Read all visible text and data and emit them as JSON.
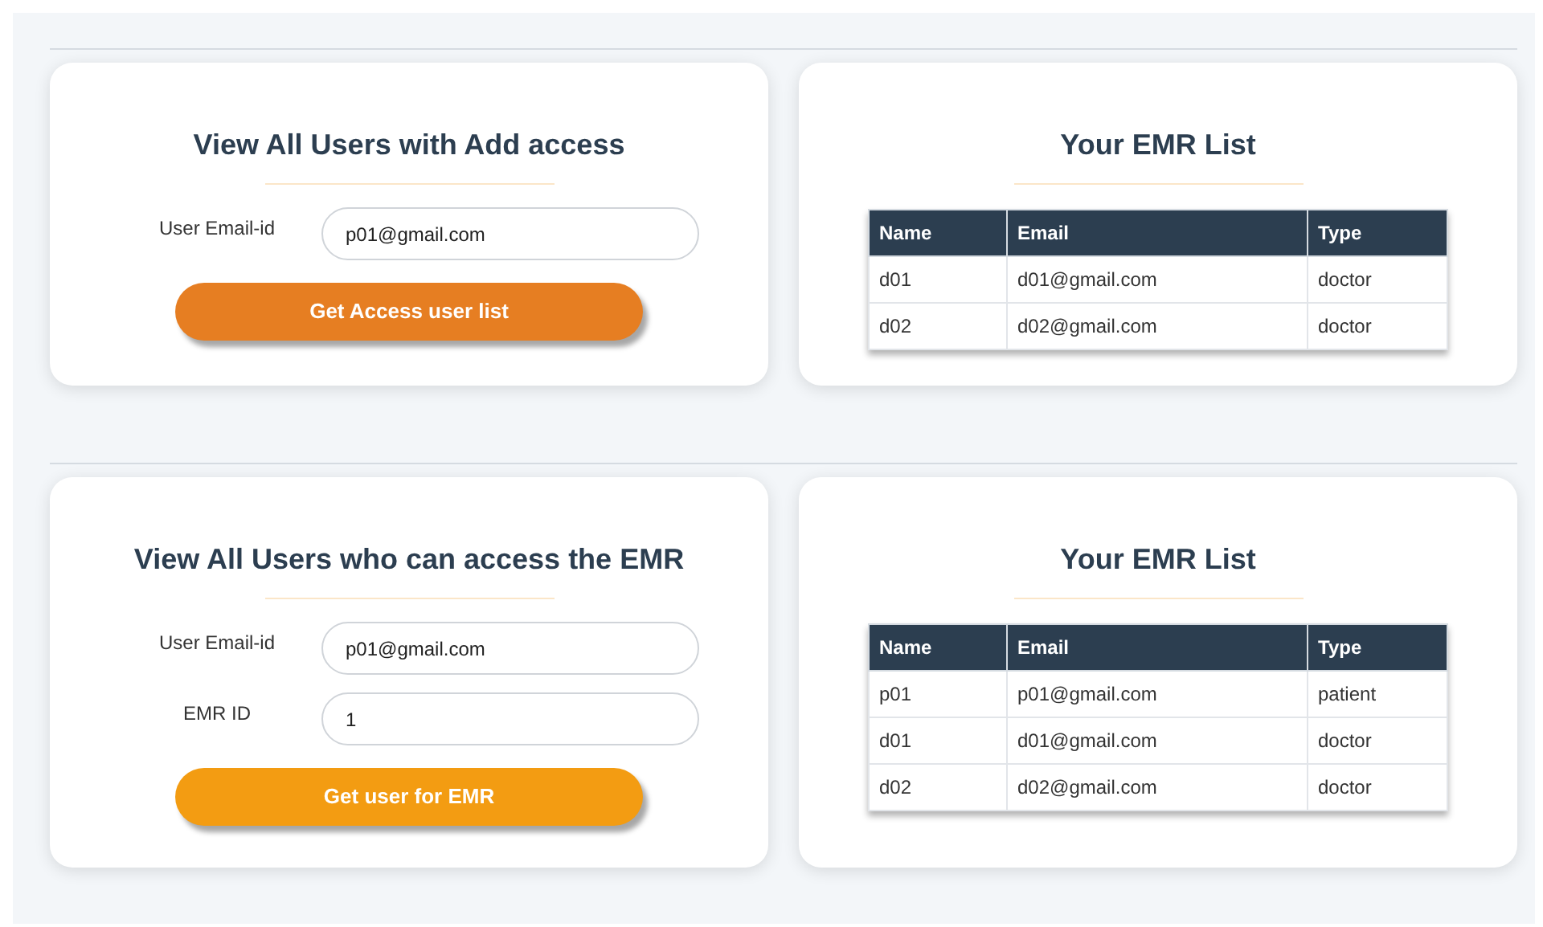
{
  "sections": [
    {
      "form": {
        "title": "View All Users with Add access",
        "fields": [
          {
            "label": "User Email-id",
            "value": "p01@gmail.com"
          }
        ],
        "button": {
          "label": "Get Access user list",
          "color": "#e67e22"
        }
      },
      "list": {
        "title": "Your EMR List",
        "columns": [
          "Name",
          "Email",
          "Type"
        ],
        "rows": [
          [
            "d01",
            "d01@gmail.com",
            "doctor"
          ],
          [
            "d02",
            "d02@gmail.com",
            "doctor"
          ]
        ]
      }
    },
    {
      "form": {
        "title": "View All Users who can access the EMR",
        "fields": [
          {
            "label": "User Email-id",
            "value": "p01@gmail.com"
          },
          {
            "label": "EMR ID",
            "value": "1"
          }
        ],
        "button": {
          "label": "Get user for EMR",
          "color": "#f39c12"
        }
      },
      "list": {
        "title": "Your EMR List",
        "columns": [
          "Name",
          "Email",
          "Type"
        ],
        "rows": [
          [
            "p01",
            "p01@gmail.com",
            "patient"
          ],
          [
            "d01",
            "d01@gmail.com",
            "doctor"
          ],
          [
            "d02",
            "d02@gmail.com",
            "doctor"
          ]
        ]
      }
    }
  ]
}
